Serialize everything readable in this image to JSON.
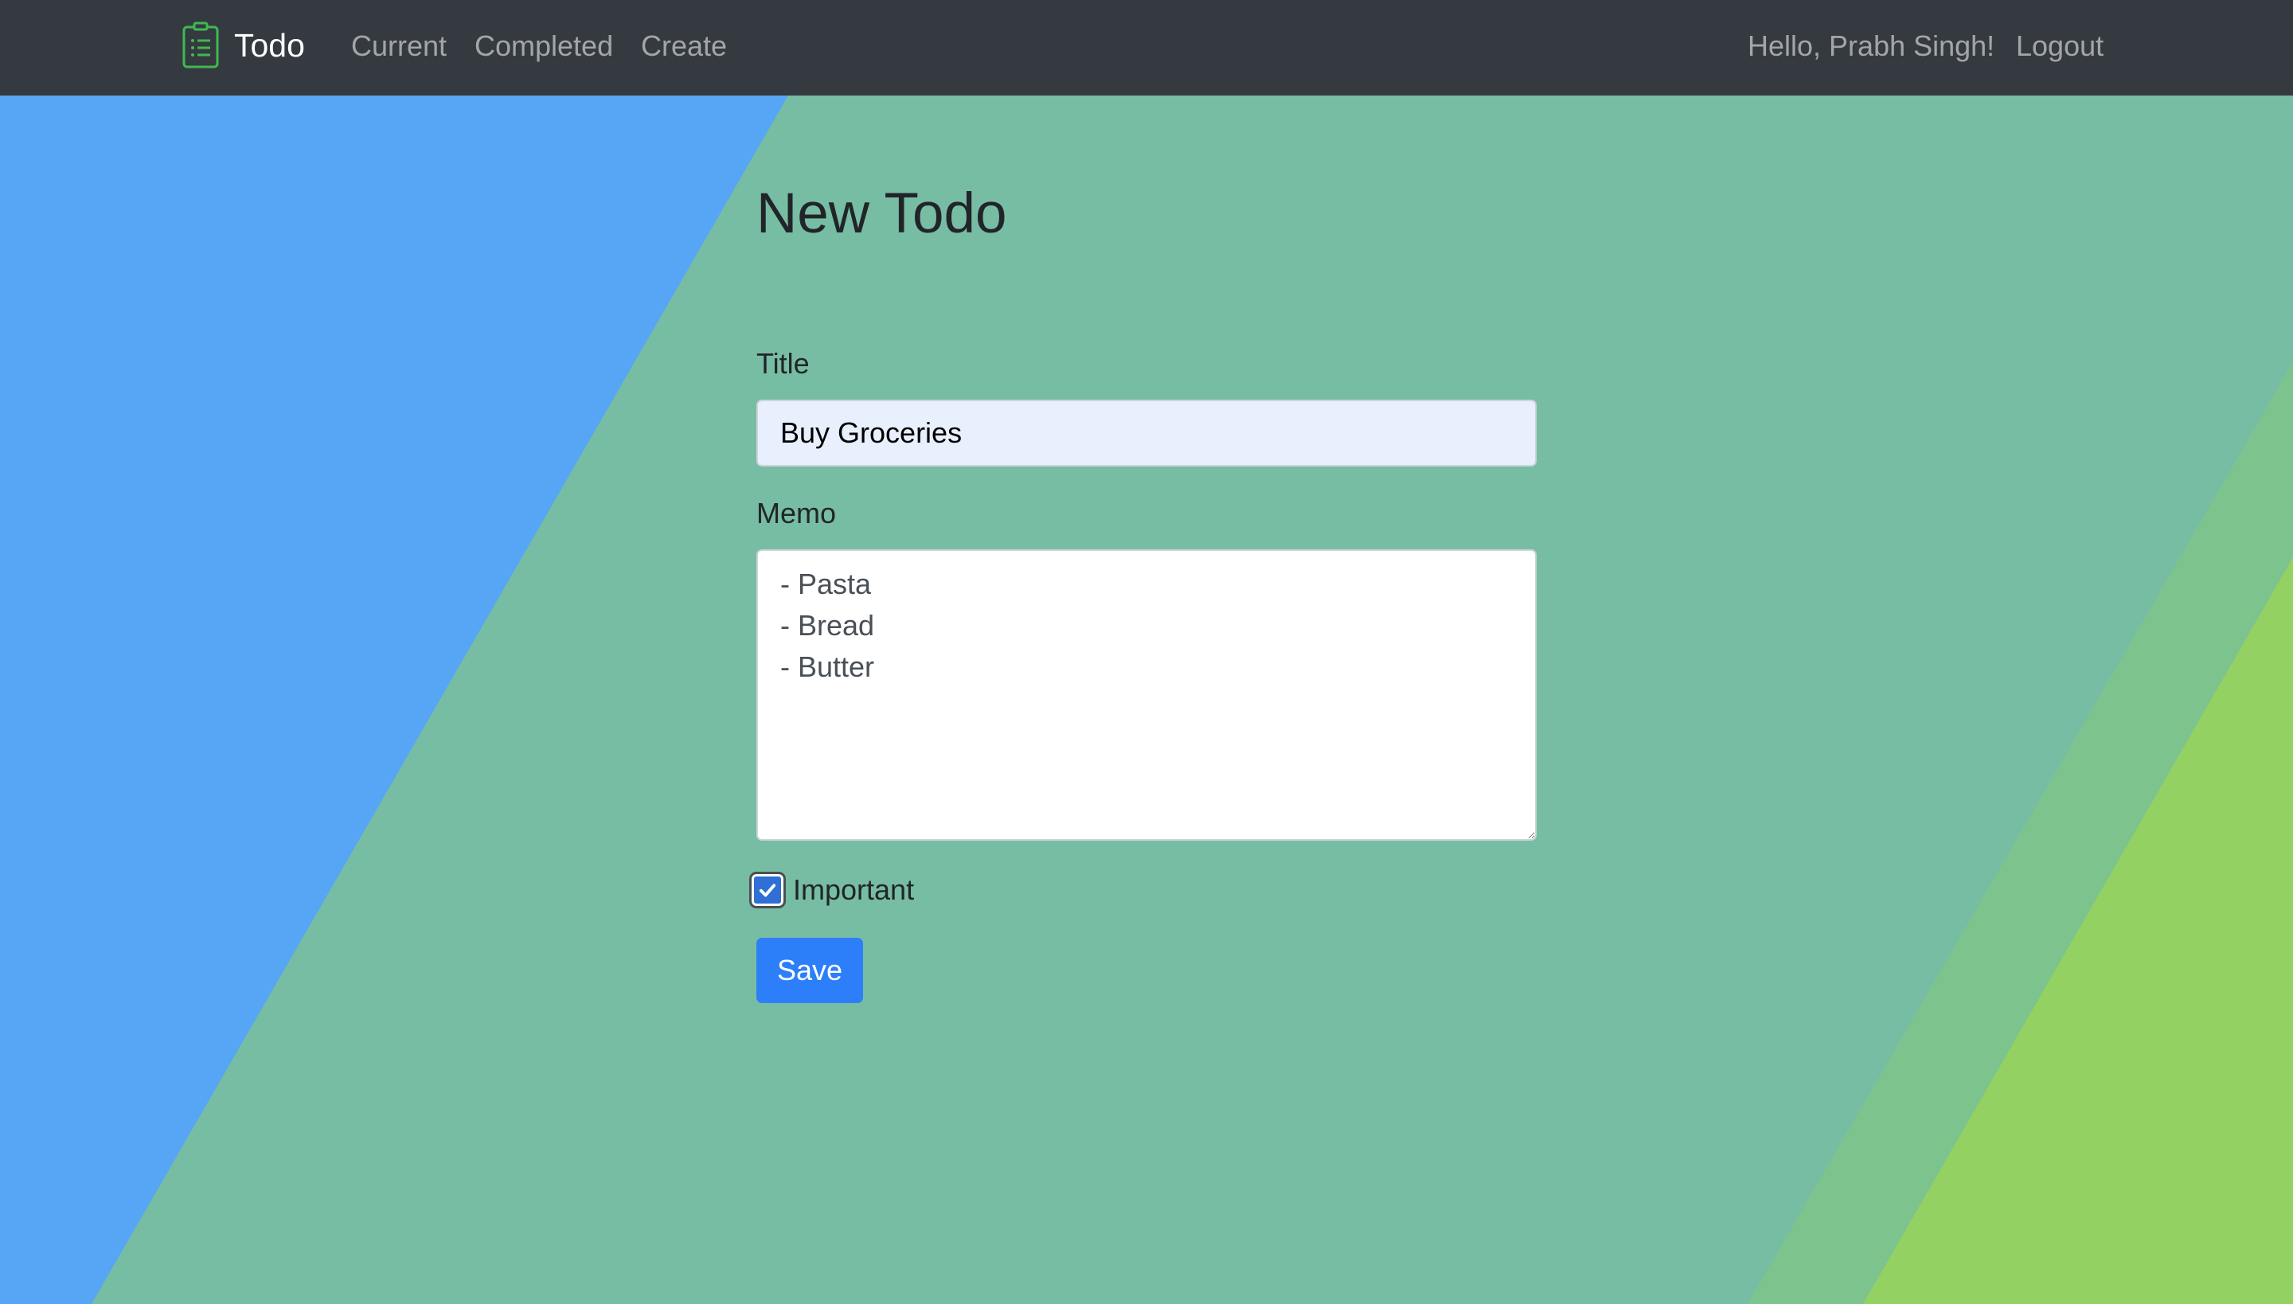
{
  "navbar": {
    "brand": "Todo",
    "links": {
      "current": "Current",
      "completed": "Completed",
      "create": "Create"
    },
    "greeting": "Hello, Prabh Singh!",
    "logout": "Logout"
  },
  "page": {
    "title": "New Todo"
  },
  "form": {
    "title_label": "Title",
    "title_value": "Buy Groceries",
    "memo_label": "Memo",
    "memo_value": "- Pasta\n- Bread\n- Butter",
    "important_label": "Important",
    "important_checked": true,
    "save_label": "Save"
  },
  "colors": {
    "navbar": "#343a40",
    "background_blue": "#57a6f5",
    "background_teal": "#77bda3",
    "background_green": "#93d162",
    "primary": "#2d7ff9",
    "brand_icon": "#3fb950"
  },
  "icons": {
    "brand": "clipboard-list-icon",
    "checkbox": "checkmark-icon"
  }
}
